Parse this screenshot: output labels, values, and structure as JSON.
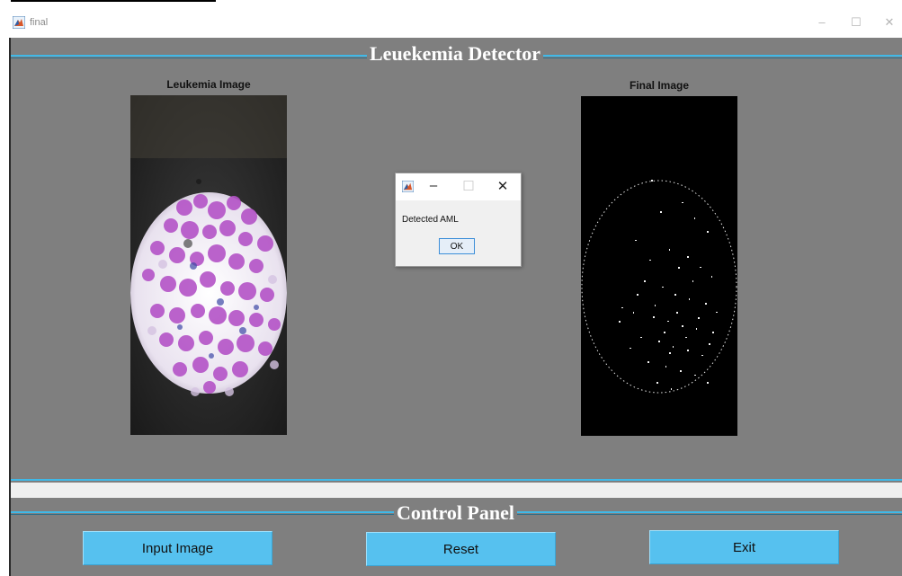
{
  "window": {
    "title": "final",
    "minimize": "–",
    "maximize": "☐",
    "close": "✕"
  },
  "main_panel": {
    "title": "Leuekemia Detector"
  },
  "left_axes": {
    "title": "Leukemia Image"
  },
  "right_axes": {
    "title": "Final Image"
  },
  "dialog": {
    "message": "Detected AML",
    "ok_label": "OK",
    "minimize": "–",
    "maximize": "☐",
    "close": "✕"
  },
  "control_panel": {
    "title": "Control Panel",
    "buttons": {
      "input": "Input Image",
      "reset": "Reset",
      "exit": "Exit"
    }
  },
  "colors": {
    "accent": "#56c1ef",
    "panel_bg": "#7f7f7f",
    "line": "#3fb9e8"
  }
}
